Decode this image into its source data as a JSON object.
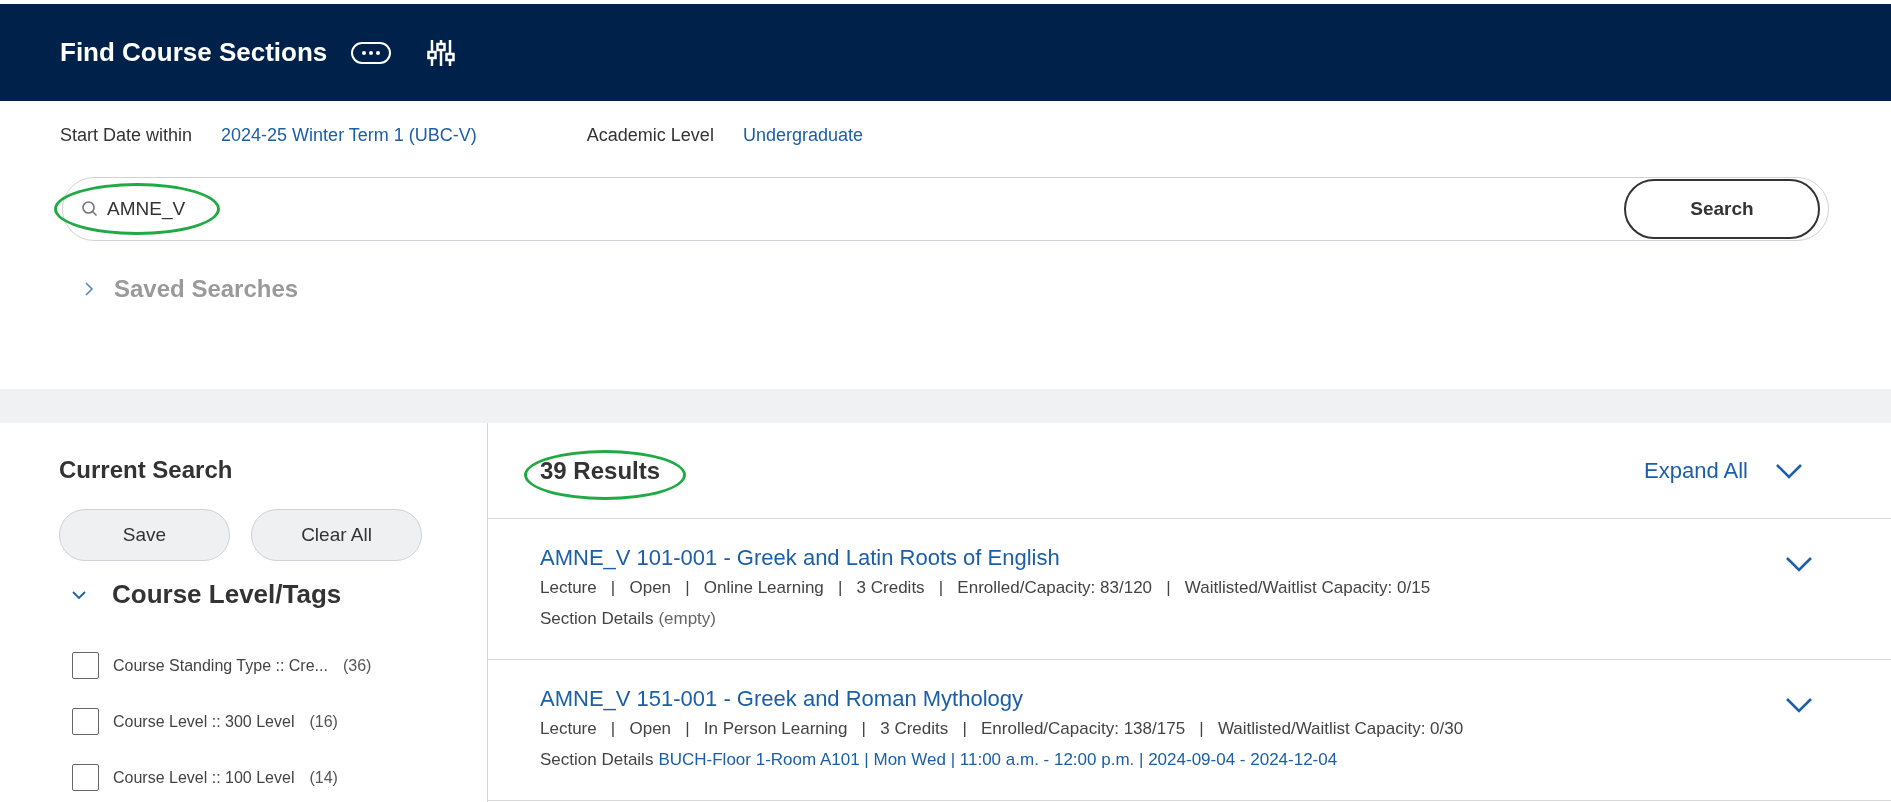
{
  "header": {
    "title": "Find Course Sections"
  },
  "filters": [
    {
      "label": "Start Date within",
      "value": "2024-25 Winter Term 1 (UBC-V)"
    },
    {
      "label": "Academic Level",
      "value": "Undergraduate"
    }
  ],
  "search": {
    "value": "AMNE_V",
    "circled": true,
    "button": "Search"
  },
  "saved_searches": {
    "label": "Saved Searches",
    "expanded": false
  },
  "current_search": {
    "title": "Current Search",
    "buttons": [
      "Save",
      "Clear All"
    ]
  },
  "facet": {
    "title": "Course Level/Tags",
    "expanded": true,
    "options": [
      {
        "label": "Course Standing Type :: Cre...",
        "count": "(36)",
        "checked": false
      },
      {
        "label": "Course Level :: 300 Level",
        "count": "(16)",
        "checked": false
      },
      {
        "label": "Course Level :: 100 Level",
        "count": "(14)",
        "checked": false
      }
    ]
  },
  "results": {
    "count": "39 Results",
    "circled": true,
    "expand_all": "Expand All",
    "items": [
      {
        "title": "AMNE_V 101-001 - Greek and Latin Roots of English",
        "meta": "Lecture   |   Open   |   Online Learning   |   3 Credits   |   Enrolled/Capacity: 83/120   |   Waitlisted/Waitlist Capacity: 0/15",
        "details_label": "Section Details",
        "details": "(empty)",
        "kind": "empty",
        "expanded": false
      },
      {
        "title": "AMNE_V 151-001 - Greek and Roman Mythology",
        "meta": "Lecture   |   Open   |   In Person Learning   |   3 Credits   |   Enrolled/Capacity: 138/175   |   Waitlisted/Waitlist Capacity: 0/30",
        "details_label": "Section Details",
        "details": "BUCH-Floor 1-Room A101 | Mon Wed | 11:00 a.m. - 12:00 p.m. | 2024-09-04 - 2024-12-04",
        "kind": "link",
        "expanded": false
      }
    ]
  }
}
